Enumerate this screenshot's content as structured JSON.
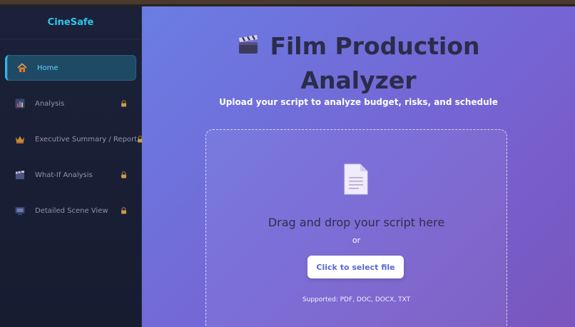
{
  "app": {
    "brand": "CineSafe"
  },
  "sidebar": {
    "items": [
      {
        "label": "Home",
        "icon": "house-icon",
        "locked": false,
        "active": true
      },
      {
        "label": "Analysis",
        "icon": "bar-chart-icon",
        "locked": true,
        "active": false
      },
      {
        "label": "Executive Summary / Report",
        "icon": "crown-icon",
        "locked": true,
        "active": false
      },
      {
        "label": "What-If Analysis",
        "icon": "clapper-icon",
        "locked": true,
        "active": false
      },
      {
        "label": "Detailed Scene View",
        "icon": "film-icon",
        "locked": true,
        "active": false
      }
    ]
  },
  "main": {
    "title_line1": "Film Production",
    "title_line2": "Analyzer",
    "subtitle": "Upload your script to analyze budget, risks, and schedule",
    "dropzone": {
      "drag_text": "Drag and drop your script here",
      "or_text": "or",
      "select_button": "Click to select file",
      "supported": "Supported: PDF, DOC, DOCX, TXT"
    }
  },
  "colors": {
    "accent": "#2fc6ee",
    "sidebar_bg": "#1b2138",
    "main_gradient_start": "#6a7de3",
    "main_gradient_end": "#7a55bd",
    "button_text": "#5a67d8"
  }
}
